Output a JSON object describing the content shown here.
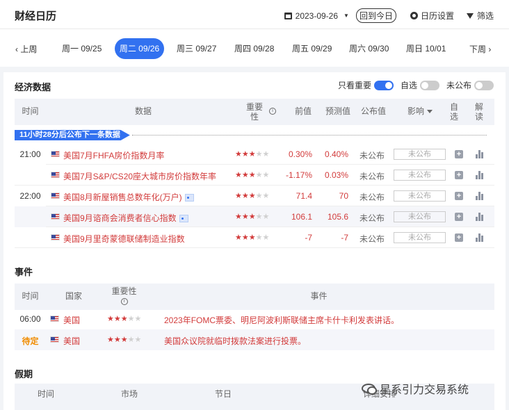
{
  "header": {
    "title": "财经日历",
    "date": "2023-09-26",
    "today_button": "回到今日",
    "settings_label": "日历设置",
    "filter_label": "筛选"
  },
  "week_nav": {
    "prev": "上周",
    "next": "下周",
    "days": [
      {
        "label": "周一 09/25",
        "active": false
      },
      {
        "label": "周二 09/26",
        "active": true
      },
      {
        "label": "周三 09/27",
        "active": false
      },
      {
        "label": "周四 09/28",
        "active": false
      },
      {
        "label": "周五 09/29",
        "active": false
      },
      {
        "label": "周六 09/30",
        "active": false
      },
      {
        "label": "周日 10/01",
        "active": false
      }
    ]
  },
  "econ": {
    "title": "经济数据",
    "toggles": {
      "important_only": "只看重要",
      "watchlist": "自选",
      "unpublished": "未公布"
    },
    "columns": {
      "time": "时间",
      "data": "数据",
      "importance_1": "重要",
      "importance_2": "性",
      "previous": "前值",
      "forecast": "预测值",
      "published": "公布值",
      "impact": "影响",
      "watch_1": "自",
      "watch_2": "选",
      "interpret_1": "解",
      "interpret_2": "读"
    },
    "countdown": "11小时28分后公布下一条数据",
    "rows": [
      {
        "time": "21:00",
        "name": "美国7月FHFA房价指数月率",
        "stars": 3,
        "previous": "0.30%",
        "forecast": "0.40%",
        "published": "未公布",
        "impact": "未公布",
        "badge": false
      },
      {
        "time": "",
        "name": "美国7月S&P/CS20座大城市房价指数年率",
        "stars": 3,
        "previous": "-1.17%",
        "forecast": "0.03%",
        "published": "未公布",
        "impact": "未公布",
        "badge": false
      },
      {
        "time": "22:00",
        "name": "美国8月新屋销售总数年化(万户)",
        "stars": 3,
        "previous": "71.4",
        "forecast": "70",
        "published": "未公布",
        "impact": "未公布",
        "badge": true
      },
      {
        "time": "",
        "name": "美国9月谘商会消费者信心指数",
        "stars": 3,
        "previous": "106.1",
        "forecast": "105.6",
        "published": "未公布",
        "impact": "未公布",
        "badge": true
      },
      {
        "time": "",
        "name": "美国9月里奇蒙德联储制造业指数",
        "stars": 3,
        "previous": "-7",
        "forecast": "-7",
        "published": "未公布",
        "impact": "未公布",
        "badge": false
      }
    ]
  },
  "events": {
    "title": "事件",
    "columns": {
      "time": "时间",
      "country": "国家",
      "importance": "重要性",
      "event": "事件"
    },
    "rows": [
      {
        "time": "06:00",
        "country": "美国",
        "stars": 3,
        "desc": "2023年FOMC票委、明尼阿波利斯联储主席卡什卡利发表讲话。",
        "pending": false
      },
      {
        "time": "待定",
        "country": "美国",
        "stars": 3,
        "desc": "美国众议院就临时拨款法案进行投票。",
        "pending": true
      }
    ]
  },
  "holidays": {
    "title": "假期",
    "columns": {
      "time": "时间",
      "market": "市场",
      "festival": "节日",
      "details": "详细安排"
    }
  },
  "watermark": "星系引力交易系统",
  "colors": {
    "accent": "#3271f0",
    "bullish_red": "#d23b3b",
    "pending": "#f08c00"
  }
}
